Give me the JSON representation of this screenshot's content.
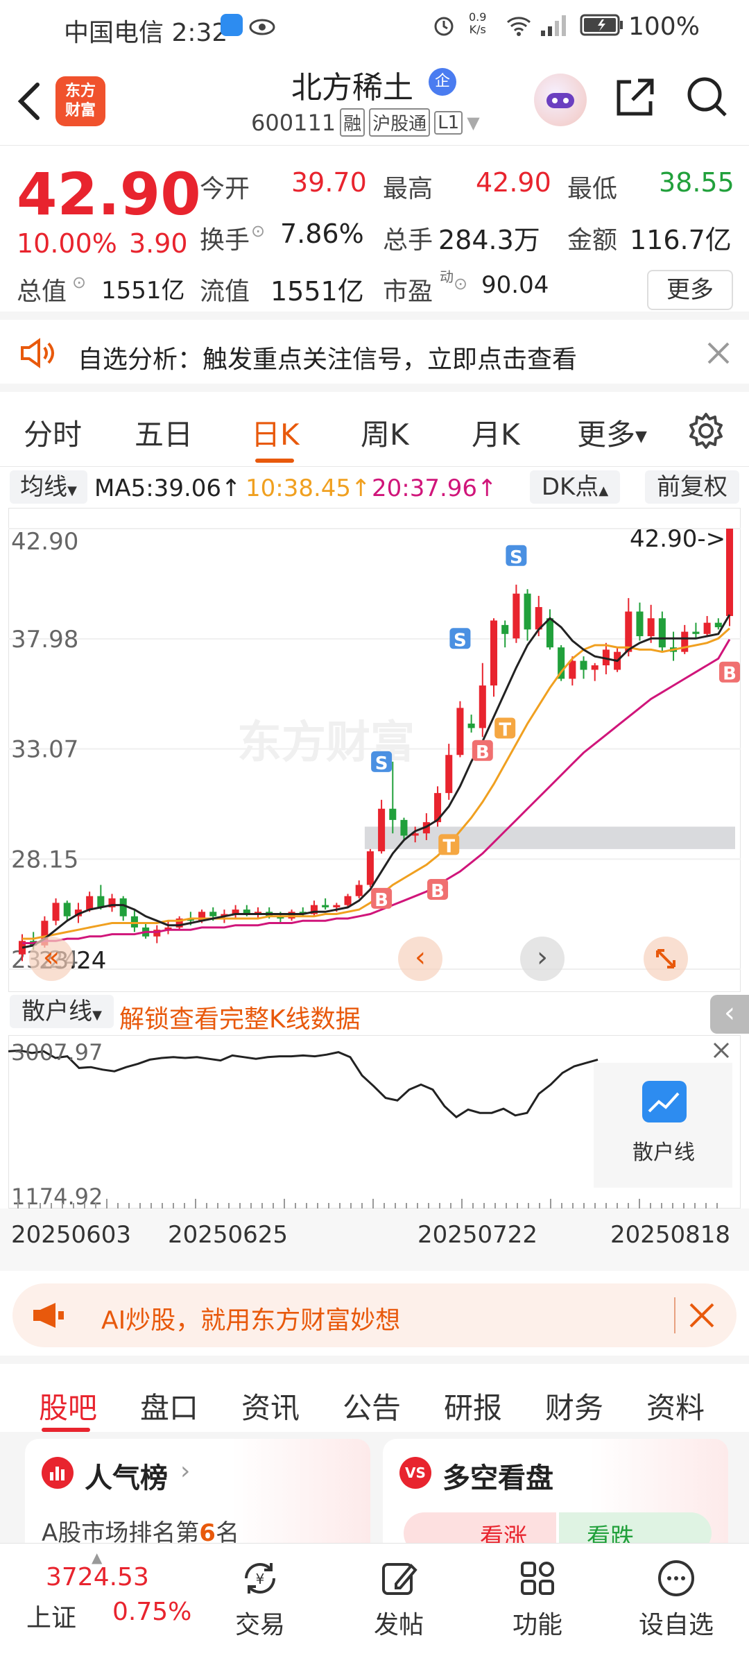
{
  "status_bar": {
    "carrier_time": "中国电信 2:32",
    "net_speed_top": "0.9",
    "net_speed_bottom": "K/s",
    "battery": "100%"
  },
  "header": {
    "stock_name": "北方稀土",
    "enterprise_badge": "企",
    "stock_code": "600111",
    "tags": [
      "融",
      "沪股通",
      "L1"
    ],
    "logo_line1": "东方",
    "logo_line2": "财富"
  },
  "quote": {
    "price": "42.90",
    "change_pct": "10.00%",
    "change_amt": "3.90",
    "open_label": "今开",
    "open": "39.70",
    "high_label": "最高",
    "high": "42.90",
    "low_label": "最低",
    "low": "38.55",
    "turnover_label": "换手",
    "turnover": "7.86%",
    "volume_label": "总手",
    "volume": "284.3万",
    "amount_label": "金额",
    "amount": "116.7亿",
    "mcap_label": "总值",
    "mcap": "1551亿",
    "float_label": "流值",
    "float_cap": "1551亿",
    "pe_label": "市盈",
    "pe_sup": "动",
    "pe": "90.04",
    "more": "更多"
  },
  "notice": {
    "text": "自选分析：触发重点关注信号，立即点击查看"
  },
  "tabs": [
    "分时",
    "五日",
    "日K",
    "周K",
    "月K",
    "更多"
  ],
  "active_tab": "日K",
  "chart_controls": {
    "ma_select": "均线",
    "ma5": "MA5:39.06",
    "ma10": "10:38.45",
    "ma20": "20:37.96",
    "dk": "DK点",
    "adjust": "前复权"
  },
  "colors": {
    "up": "#e8242e",
    "down": "#21a03b",
    "ma5": "#222222",
    "ma10": "#f0a020",
    "ma20": "#d0157a",
    "accent": "#e8590c",
    "signal_s": "#4a90e2",
    "signal_b": "#f07070",
    "signal_t": "#f5a742"
  },
  "chart_data": {
    "type": "candlestick",
    "y_ticks": [
      "42.90",
      "37.98",
      "33.07",
      "28.15",
      "23.24"
    ],
    "ylim": [
      23.24,
      42.9
    ],
    "price_flag": "42.90->",
    "low_mark": "23.24",
    "candles": [
      [
        23.9,
        24.8,
        23.6,
        24.5
      ],
      [
        24.5,
        24.9,
        24.1,
        24.3
      ],
      [
        24.3,
        25.6,
        24.2,
        25.4
      ],
      [
        25.4,
        26.4,
        25.2,
        26.2
      ],
      [
        26.2,
        26.3,
        25.4,
        25.6
      ],
      [
        25.6,
        26.2,
        25.3,
        25.9
      ],
      [
        25.9,
        26.7,
        25.8,
        26.5
      ],
      [
        26.5,
        27.0,
        25.9,
        26.0
      ],
      [
        26.0,
        26.6,
        25.8,
        26.4
      ],
      [
        26.4,
        26.5,
        25.4,
        25.6
      ],
      [
        25.6,
        25.9,
        24.9,
        25.1
      ],
      [
        25.1,
        25.3,
        24.6,
        24.7
      ],
      [
        24.7,
        25.2,
        24.4,
        25.0
      ],
      [
        25.0,
        25.4,
        24.8,
        25.1
      ],
      [
        25.1,
        25.6,
        25.0,
        25.5
      ],
      [
        25.5,
        25.8,
        25.2,
        25.4
      ],
      [
        25.4,
        25.9,
        25.3,
        25.8
      ],
      [
        25.8,
        26.0,
        25.4,
        25.6
      ],
      [
        25.6,
        25.9,
        25.3,
        25.7
      ],
      [
        25.7,
        26.1,
        25.5,
        25.9
      ],
      [
        25.9,
        26.1,
        25.6,
        25.7
      ],
      [
        25.7,
        26.0,
        25.5,
        25.8
      ],
      [
        25.8,
        26.0,
        25.5,
        25.6
      ],
      [
        25.6,
        25.8,
        25.3,
        25.5
      ],
      [
        25.5,
        25.9,
        25.4,
        25.8
      ],
      [
        25.8,
        26.0,
        25.6,
        25.7
      ],
      [
        25.7,
        26.3,
        25.6,
        26.1
      ],
      [
        26.1,
        26.4,
        25.9,
        26.0
      ],
      [
        26.0,
        26.2,
        25.8,
        26.1
      ],
      [
        26.1,
        26.6,
        26.0,
        26.5
      ],
      [
        26.5,
        27.2,
        26.4,
        27.0
      ],
      [
        27.0,
        28.6,
        26.9,
        28.5
      ],
      [
        28.5,
        30.8,
        28.4,
        30.4
      ],
      [
        30.4,
        32.5,
        29.3,
        29.9
      ],
      [
        29.9,
        30.0,
        29.0,
        29.2
      ],
      [
        29.2,
        29.6,
        28.9,
        29.3
      ],
      [
        29.3,
        30.2,
        29.0,
        29.8
      ],
      [
        29.8,
        31.4,
        29.6,
        31.1
      ],
      [
        31.1,
        33.3,
        30.8,
        32.8
      ],
      [
        32.8,
        35.2,
        32.7,
        34.9
      ],
      [
        34.2,
        34.6,
        33.8,
        34.0
      ],
      [
        34.0,
        36.9,
        33.6,
        35.9
      ],
      [
        35.9,
        38.9,
        35.4,
        38.8
      ],
      [
        38.6,
        38.8,
        37.6,
        38.2
      ],
      [
        38.0,
        40.4,
        37.8,
        40.0
      ],
      [
        40.0,
        40.2,
        37.9,
        38.4
      ],
      [
        38.4,
        39.9,
        38.1,
        39.4
      ],
      [
        38.9,
        39.3,
        37.5,
        37.6
      ],
      [
        37.6,
        37.7,
        36.1,
        36.2
      ],
      [
        36.2,
        37.2,
        35.9,
        37.0
      ],
      [
        37.0,
        37.2,
        36.2,
        36.6
      ],
      [
        36.6,
        36.9,
        36.1,
        36.8
      ],
      [
        36.8,
        37.8,
        36.4,
        37.5
      ],
      [
        36.6,
        37.6,
        36.5,
        37.4
      ],
      [
        37.4,
        39.8,
        37.2,
        39.2
      ],
      [
        39.2,
        39.6,
        37.9,
        38.1
      ],
      [
        38.1,
        39.5,
        37.8,
        38.9
      ],
      [
        38.9,
        39.2,
        37.4,
        37.6
      ],
      [
        37.6,
        38.3,
        37.0,
        37.4
      ],
      [
        37.4,
        38.6,
        37.3,
        38.3
      ],
      [
        38.3,
        38.7,
        38.0,
        38.2
      ],
      [
        38.2,
        39.0,
        38.1,
        38.7
      ],
      [
        38.7,
        38.9,
        38.4,
        38.5
      ],
      [
        39.0,
        42.9,
        38.55,
        42.9
      ]
    ],
    "ma5": [
      24.2,
      24.3,
      24.6,
      25.0,
      25.4,
      25.7,
      25.9,
      26.0,
      26.1,
      26.1,
      25.9,
      25.6,
      25.4,
      25.2,
      25.2,
      25.3,
      25.4,
      25.5,
      25.6,
      25.7,
      25.7,
      25.7,
      25.7,
      25.7,
      25.7,
      25.7,
      25.8,
      25.8,
      25.9,
      26.0,
      26.3,
      26.8,
      27.6,
      28.4,
      29.0,
      29.4,
      29.6,
      29.9,
      30.5,
      31.4,
      32.5,
      33.4,
      34.5,
      35.6,
      36.7,
      37.7,
      38.4,
      38.9,
      38.5,
      37.9,
      37.5,
      37.2,
      37.1,
      37.0,
      37.5,
      37.8,
      38.0,
      38.0,
      38.0,
      38.0,
      38.0,
      38.1,
      38.2,
      39.06
    ],
    "ma10": [
      24.6,
      24.6,
      24.7,
      24.8,
      24.9,
      25.0,
      25.1,
      25.2,
      25.3,
      25.3,
      25.3,
      25.3,
      25.3,
      25.4,
      25.4,
      25.5,
      25.5,
      25.5,
      25.5,
      25.5,
      25.5,
      25.5,
      25.6,
      25.6,
      25.6,
      25.6,
      25.6,
      25.7,
      25.7,
      25.8,
      25.9,
      26.2,
      26.6,
      27.0,
      27.3,
      27.6,
      27.9,
      28.3,
      28.8,
      29.4,
      30.0,
      30.7,
      31.5,
      32.4,
      33.3,
      34.2,
      35.0,
      35.8,
      36.5,
      37.1,
      37.5,
      37.7,
      37.7,
      37.6,
      37.6,
      37.5,
      37.5,
      37.4,
      37.5,
      37.6,
      37.7,
      37.8,
      38.0,
      38.45
    ],
    "ma20": [
      24.4,
      24.4,
      24.5,
      24.5,
      24.6,
      24.6,
      24.7,
      24.7,
      24.8,
      24.8,
      24.8,
      24.9,
      24.9,
      25.0,
      25.0,
      25.0,
      25.1,
      25.1,
      25.1,
      25.2,
      25.2,
      25.2,
      25.3,
      25.3,
      25.3,
      25.4,
      25.4,
      25.4,
      25.5,
      25.5,
      25.6,
      25.7,
      25.9,
      26.1,
      26.3,
      26.5,
      26.7,
      27.0,
      27.3,
      27.6,
      28.0,
      28.4,
      28.9,
      29.4,
      29.9,
      30.4,
      30.9,
      31.4,
      31.9,
      32.4,
      32.9,
      33.3,
      33.7,
      34.1,
      34.5,
      34.9,
      35.3,
      35.6,
      35.9,
      36.2,
      36.5,
      36.8,
      37.1,
      37.96
    ],
    "signals": [
      {
        "day": 32,
        "type": "S",
        "price": 32.5
      },
      {
        "day": 32,
        "type": "B",
        "price": 26.4
      },
      {
        "day": 37,
        "type": "B",
        "price": 26.8
      },
      {
        "day": 38,
        "type": "T",
        "price": 28.8
      },
      {
        "day": 39,
        "type": "S",
        "price": 38.0
      },
      {
        "day": 41,
        "type": "B",
        "price": 33.0
      },
      {
        "day": 43,
        "type": "T",
        "price": 34.0
      },
      {
        "day": 44,
        "type": "S",
        "price": 41.7
      },
      {
        "day": 63,
        "type": "B",
        "price": 36.5
      }
    ],
    "shaded_band": [
      28.6,
      29.6
    ],
    "watermark": "东方财富"
  },
  "sub": {
    "select": "散户线",
    "unlock": "解锁查看完整K线数据",
    "y_top": "3007.97",
    "y_bottom": "1174.92",
    "widget_label": "散户线",
    "series": [
      2980,
      2990,
      2960,
      2980,
      2900,
      2920,
      2780,
      2790,
      2760,
      2740,
      2790,
      2830,
      2880,
      2900,
      2910,
      2900,
      2910,
      2890,
      2870,
      2930,
      2910,
      2890,
      2910,
      2920,
      2920,
      2930,
      2920,
      2940,
      2970,
      2910,
      2690,
      2560,
      2420,
      2390,
      2520,
      2580,
      2520,
      2320,
      2190,
      2280,
      2240,
      2240,
      2290,
      2210,
      2240,
      2470,
      2580,
      2720,
      2800,
      2840,
      2880
    ]
  },
  "dates": [
    "20250603",
    "20250625",
    "20250722",
    "20250818"
  ],
  "ai_banner": {
    "text": "AI炒股，就用东方财富妙想"
  },
  "bottom_tabs": [
    "股吧",
    "盘口",
    "资讯",
    "公告",
    "研报",
    "财务",
    "资料"
  ],
  "active_bottom_tab": "股吧",
  "cards": {
    "popularity_title": "人气榜",
    "popularity_rank_prefix": "A股市场排名第",
    "popularity_rank": "6",
    "popularity_rank_suffix": "名",
    "bullbear_title": "多空看盘",
    "bull": "看涨",
    "bear": "看跌",
    "vs": "VS"
  },
  "bottom_nav": {
    "index_value": "3724.53",
    "index_name": "上证",
    "index_change": "0.75%",
    "items": [
      "交易",
      "发帖",
      "功能",
      "设自选"
    ]
  }
}
